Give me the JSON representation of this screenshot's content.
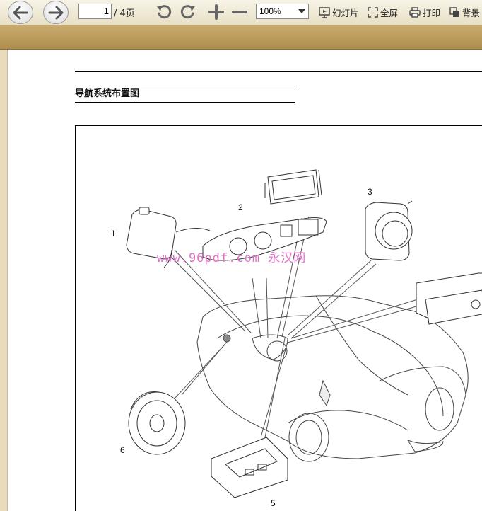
{
  "toolbar": {
    "back_icon": "arrow-left-icon",
    "forward_icon": "arrow-right-icon",
    "page_current": "1",
    "page_total": "/ 4页",
    "rotate_left_icon": "rotate-ccw-icon",
    "rotate_right_icon": "rotate-cw-icon",
    "zoom_in_icon": "plus-icon",
    "zoom_out_icon": "minus-icon",
    "zoom_value": "100%",
    "slideshow_label": "幻灯片",
    "fullscreen_label": "全屏",
    "print_label": "打印",
    "background_label": "背景"
  },
  "document": {
    "title": "导航系统布置图",
    "watermark": "www.96pdf.com 永汉网",
    "callouts": [
      "1",
      "2",
      "3",
      "5",
      "6"
    ]
  }
}
